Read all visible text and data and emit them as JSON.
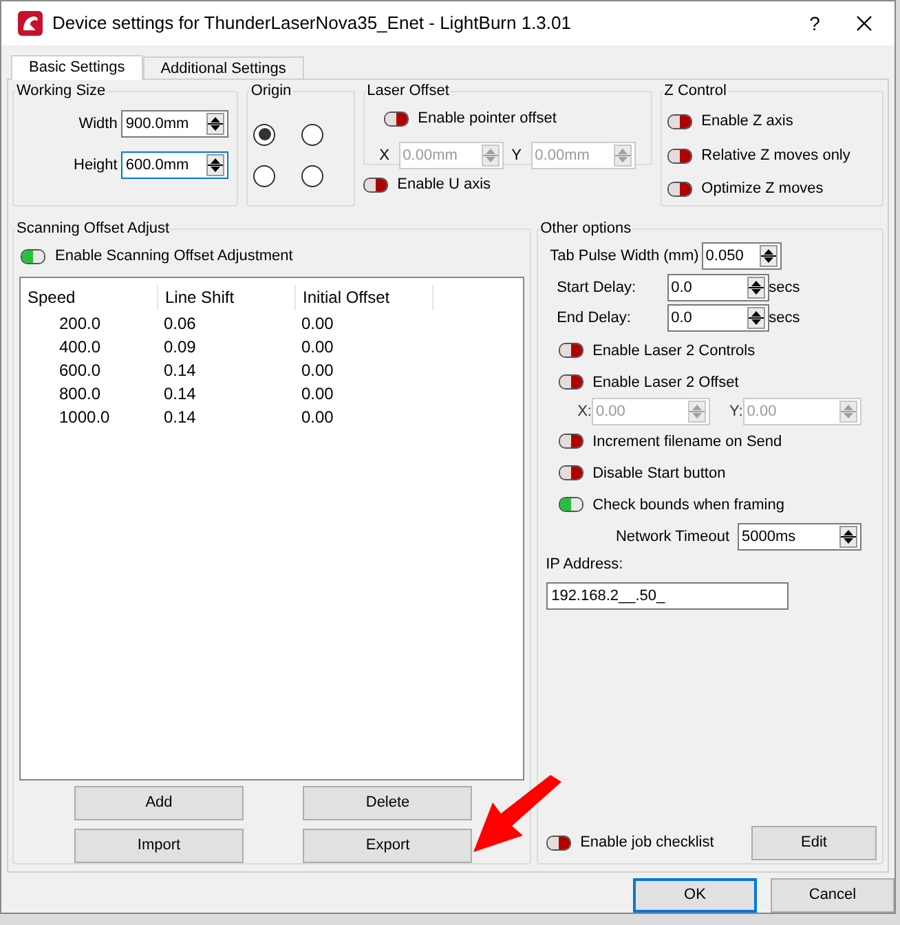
{
  "window": {
    "title": "Device settings for ThunderLaserNova35_Enet - LightBurn 1.3.01",
    "help": "?"
  },
  "tabs": [
    {
      "label": "Basic Settings",
      "selected": true
    },
    {
      "label": "Additional Settings",
      "selected": false
    }
  ],
  "working_size": {
    "title": "Working Size",
    "fields": [
      {
        "label": "Width",
        "value": "900.0mm",
        "focused": false
      },
      {
        "label": "Height",
        "value": "600.0mm",
        "focused": true
      }
    ]
  },
  "origin": {
    "title": "Origin",
    "options": [
      {
        "selected": true
      },
      {
        "selected": false
      },
      {
        "selected": false
      },
      {
        "selected": false
      }
    ]
  },
  "laser_offset": {
    "title": "Laser Offset",
    "toggle": {
      "label": "Enable pointer offset",
      "on": false
    },
    "fields": [
      {
        "label": "X",
        "value": "0.00mm",
        "disabled": true
      },
      {
        "label": "Y",
        "value": "0.00mm",
        "disabled": true
      }
    ],
    "u_axis": {
      "label": "Enable U axis",
      "on": false
    }
  },
  "z_control": {
    "title": "Z Control",
    "toggles": [
      {
        "label": "Enable Z axis",
        "on": false
      },
      {
        "label": "Relative Z moves only",
        "on": false
      },
      {
        "label": "Optimize Z moves",
        "on": false
      }
    ]
  },
  "scanning": {
    "title": "Scanning Offset Adjust",
    "toggle": {
      "label": "Enable Scanning Offset Adjustment",
      "on": true
    },
    "table": {
      "columns": [
        "Speed",
        "Line Shift",
        "Initial Offset"
      ],
      "rows": [
        [
          "200.0",
          "0.06",
          "0.00"
        ],
        [
          "400.0",
          "0.09",
          "0.00"
        ],
        [
          "600.0",
          "0.14",
          "0.00"
        ],
        [
          "800.0",
          "0.14",
          "0.00"
        ],
        [
          "1000.0",
          "0.14",
          "0.00"
        ]
      ]
    },
    "buttons": [
      "Add",
      "Delete",
      "Import",
      "Export"
    ]
  },
  "other_options": {
    "title": "Other options",
    "items": [
      {
        "kind": "spin",
        "label": "Tab Pulse Width (mm)",
        "value": "0.050"
      },
      {
        "kind": "delay",
        "label": "Start Delay:",
        "value": "0.0",
        "unit": "secs"
      },
      {
        "kind": "delay",
        "label": "End Delay:",
        "value": "0.0",
        "unit": "secs"
      },
      {
        "kind": "toggle",
        "label": "Enable Laser 2 Controls",
        "on": false
      },
      {
        "kind": "toggle",
        "label": "Enable Laser 2 Offset",
        "on": false
      },
      {
        "kind": "pair",
        "fields": [
          {
            "label": "X:",
            "value": "0.00",
            "disabled": true
          },
          {
            "label": "Y:",
            "value": "0.00",
            "disabled": true
          }
        ]
      },
      {
        "kind": "toggle",
        "label": "Increment filename on Send",
        "on": false
      },
      {
        "kind": "toggle",
        "label": "Disable Start button",
        "on": false
      },
      {
        "kind": "toggle",
        "label": "Check bounds when framing",
        "on": true
      },
      {
        "kind": "timeout",
        "label": "Network Timeout",
        "value": "5000ms"
      },
      {
        "kind": "text",
        "label": "IP Address:",
        "value": "192.168.2__.50_"
      }
    ],
    "job_checklist": {
      "label": "Enable job checklist",
      "on": false
    },
    "edit_button": "Edit"
  },
  "dialog_buttons": [
    {
      "label": "OK",
      "default": true
    },
    {
      "label": "Cancel",
      "default": false
    }
  ]
}
